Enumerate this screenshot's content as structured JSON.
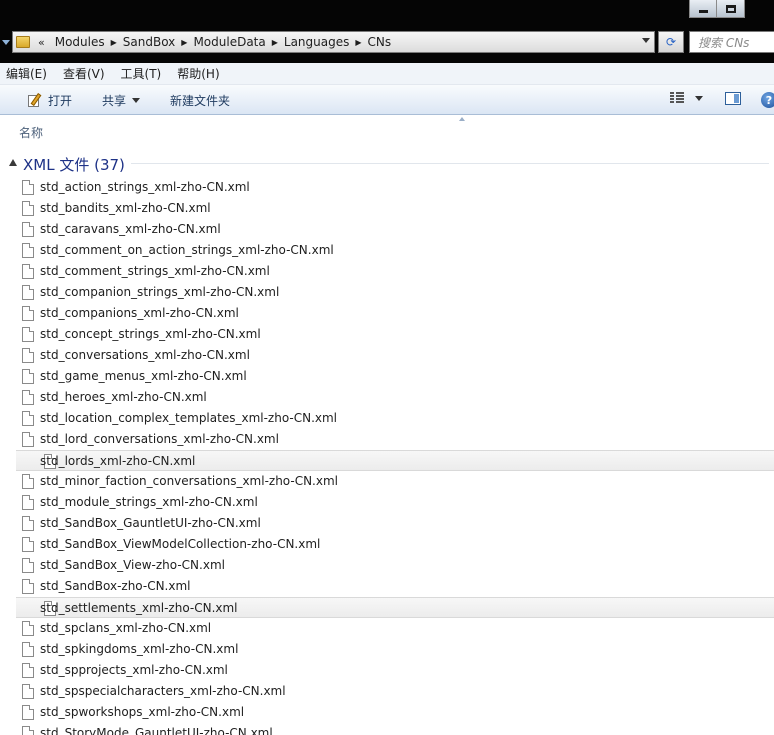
{
  "window": {
    "minimize_icon": "minimize-icon",
    "maximize_icon": "maximize-icon"
  },
  "address": {
    "overflow": "«",
    "path": [
      "Modules",
      "SandBox",
      "ModuleData",
      "Languages",
      "CNs"
    ],
    "search_placeholder": "搜索 CNs"
  },
  "menu": {
    "items": [
      "编辑(E)",
      "查看(V)",
      "工具(T)",
      "帮助(H)"
    ]
  },
  "commands": {
    "open": "打开",
    "share": "共享",
    "new_folder": "新建文件夹"
  },
  "columns": {
    "name": "名称"
  },
  "group": {
    "title": "XML 文件 (37)"
  },
  "files": [
    {
      "name": "std_action_strings_xml-zho-CN.xml",
      "selected": false
    },
    {
      "name": "std_bandits_xml-zho-CN.xml",
      "selected": false
    },
    {
      "name": "std_caravans_xml-zho-CN.xml",
      "selected": false
    },
    {
      "name": "std_comment_on_action_strings_xml-zho-CN.xml",
      "selected": false
    },
    {
      "name": "std_comment_strings_xml-zho-CN.xml",
      "selected": false
    },
    {
      "name": "std_companion_strings_xml-zho-CN.xml",
      "selected": false
    },
    {
      "name": "std_companions_xml-zho-CN.xml",
      "selected": false
    },
    {
      "name": "std_concept_strings_xml-zho-CN.xml",
      "selected": false
    },
    {
      "name": "std_conversations_xml-zho-CN.xml",
      "selected": false
    },
    {
      "name": "std_game_menus_xml-zho-CN.xml",
      "selected": false
    },
    {
      "name": "std_heroes_xml-zho-CN.xml",
      "selected": false
    },
    {
      "name": "std_location_complex_templates_xml-zho-CN.xml",
      "selected": false
    },
    {
      "name": "std_lord_conversations_xml-zho-CN.xml",
      "selected": false
    },
    {
      "name": "std_lords_xml-zho-CN.xml",
      "selected": true
    },
    {
      "name": "std_minor_faction_conversations_xml-zho-CN.xml",
      "selected": false
    },
    {
      "name": "std_module_strings_xml-zho-CN.xml",
      "selected": false
    },
    {
      "name": "std_SandBox_GauntletUI-zho-CN.xml",
      "selected": false
    },
    {
      "name": "std_SandBox_ViewModelCollection-zho-CN.xml",
      "selected": false
    },
    {
      "name": "std_SandBox_View-zho-CN.xml",
      "selected": false
    },
    {
      "name": "std_SandBox-zho-CN.xml",
      "selected": false
    },
    {
      "name": "std_settlements_xml-zho-CN.xml",
      "selected": true
    },
    {
      "name": "std_spclans_xml-zho-CN.xml",
      "selected": false
    },
    {
      "name": "std_spkingdoms_xml-zho-CN.xml",
      "selected": false
    },
    {
      "name": "std_spprojects_xml-zho-CN.xml",
      "selected": false
    },
    {
      "name": "std_spspecialcharacters_xml-zho-CN.xml",
      "selected": false
    },
    {
      "name": "std_spworkshops_xml-zho-CN.xml",
      "selected": false
    },
    {
      "name": "std_StoryMode_GauntletUI-zho-CN.xml",
      "selected": false
    }
  ]
}
